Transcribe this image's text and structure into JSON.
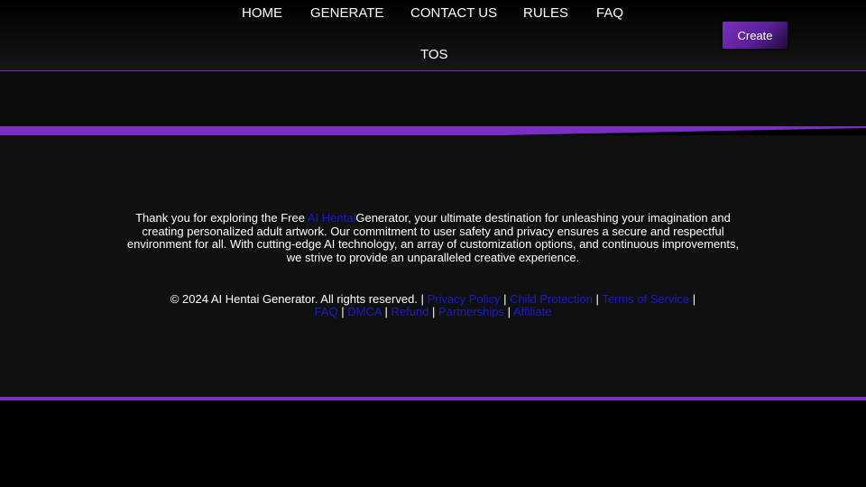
{
  "nav": {
    "home": "HOME",
    "generate": "GENERATE",
    "contact": "CONTACT US",
    "rules": "RULES",
    "faq": "FAQ",
    "tos": "TOS"
  },
  "header": {
    "create_label": "Create"
  },
  "intro": {
    "prefix": "Thank you for exploring the Free ",
    "link": "AI Hentai",
    "suffix": "Generator, your ultimate destination for unleashing your imagination and creating personalized adult artwork. Our commitment to user safety and privacy ensures a secure and respectful environment for all. With cutting-edge AI technology, an array of customization options, and continuous improvements, we strive to provide an unparalleled creative experience."
  },
  "footer": {
    "copyright": "© 2024 AI Hentai Generator. All rights reserved.",
    "sep": "|",
    "links": {
      "privacy": "Privacy Policy",
      "child": "Child Protection",
      "terms": "Terms of Service",
      "faq": "FAQ",
      "dmca": "DMCA",
      "refund": "Refund",
      "partnerships": "Partnerships",
      "affiliate": "Affiliate"
    }
  },
  "colors": {
    "accent": "#7a2fc0",
    "link": "#1a1acc",
    "background": "#101010"
  }
}
